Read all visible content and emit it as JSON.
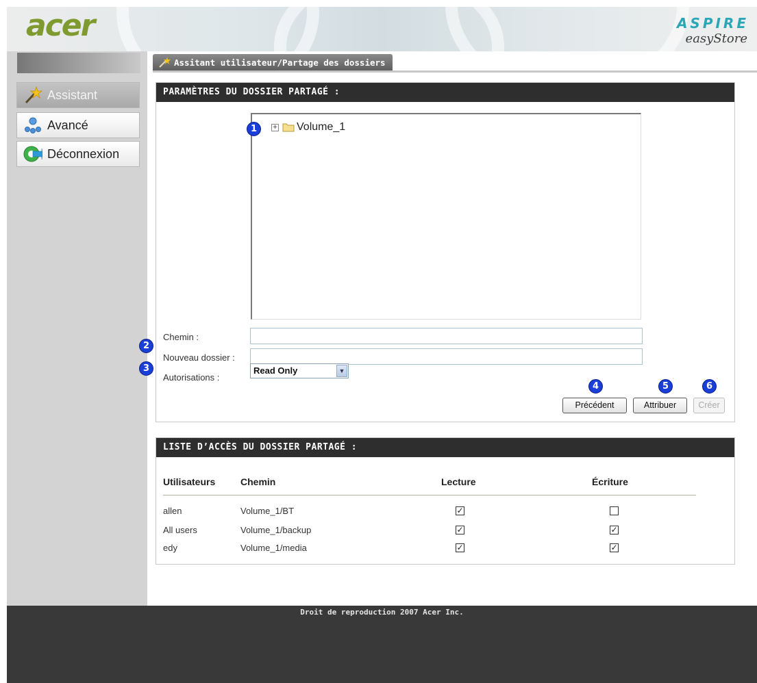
{
  "header": {
    "logo": "acer",
    "product_line": "ASPIRE",
    "product_name": "easyStore"
  },
  "sidebar": {
    "items": [
      {
        "label": "Assistant",
        "icon": "magic-wand-icon",
        "active": true
      },
      {
        "label": "Avancé",
        "icon": "network-nodes-icon",
        "active": false
      },
      {
        "label": "Déconnexion",
        "icon": "logout-arrow-icon",
        "active": false
      }
    ]
  },
  "tab": {
    "label": "Assitant utilisateur/Partage des dossiers",
    "icon": "magic-wand-icon"
  },
  "share_settings": {
    "title": "PARAMÈTRES DU DOSSIER PARTAGÉ :",
    "tree": [
      {
        "label": "Volume_1",
        "expander": "+",
        "icon": "folder-icon"
      }
    ],
    "path_label": "Chemin :",
    "path_value": "",
    "new_folder_label": "Nouveau dossier :",
    "new_folder_value": "",
    "permissions_label": "Autorisations :",
    "permissions_value": "Read Only",
    "buttons": {
      "previous": "Précédent",
      "assign": "Attribuer",
      "create": "Créer"
    }
  },
  "markers": [
    "1",
    "2",
    "3",
    "4",
    "5",
    "6"
  ],
  "access_list": {
    "title": "LISTE D’ACCÈS DU DOSSIER PARTAGÉ :",
    "columns": [
      "Utilisateurs",
      "Chemin",
      "Lecture",
      "Écriture"
    ],
    "rows": [
      {
        "user": "allen",
        "path": "Volume_1/BT",
        "read": true,
        "write": false
      },
      {
        "user": "All users",
        "path": "Volume_1/backup",
        "read": true,
        "write": true
      },
      {
        "user": "edy",
        "path": "Volume_1/media",
        "read": true,
        "write": true
      }
    ]
  },
  "colors": {
    "sidebar_bg": "#d3d3d3",
    "panel_header_bg": "#2e2e2e",
    "footer_bg": "#393939",
    "marker_blue": "#1a3fd6",
    "logo_green": "#7f9a2e",
    "aspire_teal": "#2aa7b7"
  },
  "footer": {
    "copyright": "Droit de reproduction 2007 Acer Inc."
  }
}
